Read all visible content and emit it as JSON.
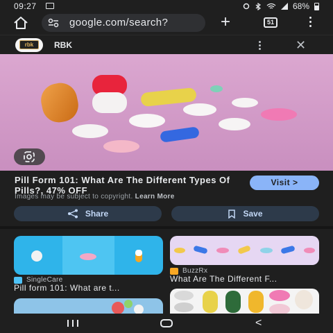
{
  "status_bar": {
    "time": "09:27",
    "battery": "68%",
    "icons": [
      "image-icon",
      "alarm-icon",
      "bluetooth-icon",
      "wifi-icon",
      "signal-icon",
      "battery-icon"
    ]
  },
  "browser": {
    "url": "google.com/search?",
    "tab_count": "51",
    "icons": [
      "home-icon",
      "site-settings-icon",
      "new-tab-icon",
      "tab-switcher-icon",
      "menu-icon"
    ]
  },
  "panel": {
    "site_logo_text": "rbk",
    "site_name": "RBK"
  },
  "result": {
    "title": "Pill Form 101: What Are The Different Types Of Pills?, 47% OFF",
    "visit_label": "Visit >",
    "copyright_text": "Images may be subject to copyright.",
    "learn_more": "Learn More",
    "share_label": "Share",
    "save_label": "Save"
  },
  "related": [
    {
      "source": "SingleCare",
      "title": "Pill form 101: What are t...",
      "source_color": "#4fc3f7"
    },
    {
      "source": "BuzzRx",
      "title": "What Are The Different F...",
      "source_color": "#f9a825"
    }
  ],
  "colors": {
    "accent": "#8ab4f8",
    "background": "#1f1f1f",
    "button_bg": "#2d3a4a",
    "hero_bg": "#d9a6cf"
  }
}
